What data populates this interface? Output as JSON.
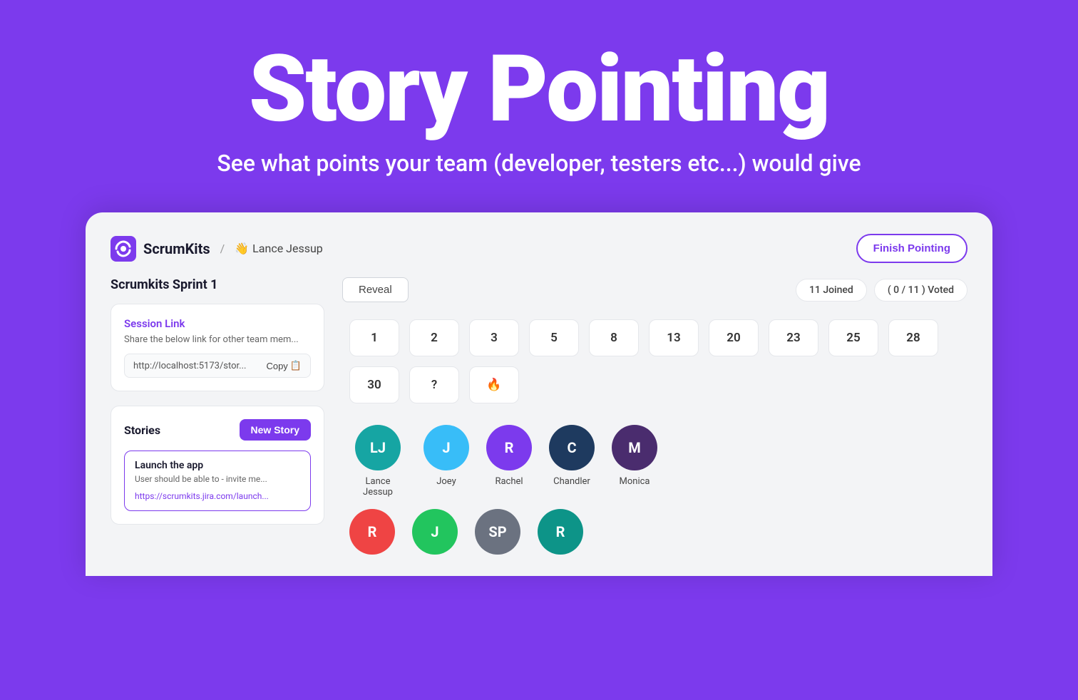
{
  "hero": {
    "title": "Story Pointing",
    "subtitle": "See what points your team (developer, testers etc...) would give"
  },
  "header": {
    "brand_name": "ScrumKits",
    "separator": "/",
    "user_emoji": "👋",
    "user_name": "Lance Jessup",
    "finish_btn": "Finish Pointing"
  },
  "left": {
    "sprint_title": "Scrumkits Sprint 1",
    "session_card": {
      "title": "Session Link",
      "desc": "Share the below link for other team mem...",
      "link_text": "http://localhost:5173/stor...",
      "copy_label": "Copy",
      "copy_icon": "📋"
    },
    "stories": {
      "label": "Stories",
      "new_story_btn": "New Story",
      "items": [
        {
          "name": "Launch the app",
          "desc": "User should be able to - invite me...",
          "link": "https://scrumkits.jira.com/launch..."
        }
      ]
    }
  },
  "right": {
    "reveal_btn": "Reveal",
    "badges": {
      "joined": "11 Joined",
      "voted": "( 0 / 11 ) Voted"
    },
    "point_values": [
      "1",
      "2",
      "3",
      "5",
      "8",
      "13",
      "20",
      "23",
      "25",
      "28",
      "30",
      "?",
      "🔥"
    ],
    "participants_row1": [
      {
        "initials": "LJ",
        "name": "Lance Jessup",
        "color": "#16a5a3"
      },
      {
        "initials": "J",
        "name": "Joey",
        "color": "#38bdf8"
      },
      {
        "initials": "R",
        "name": "Rachel",
        "color": "#7c3aed"
      },
      {
        "initials": "C",
        "name": "Chandler",
        "color": "#1e3a5f"
      },
      {
        "initials": "M",
        "name": "Monica",
        "color": "#4a2c6e"
      }
    ],
    "participants_row2": [
      {
        "initials": "R",
        "name": "",
        "color": "#ef4444"
      },
      {
        "initials": "J",
        "name": "",
        "color": "#22c55e"
      },
      {
        "initials": "SP",
        "name": "",
        "color": "#6b7280"
      },
      {
        "initials": "R",
        "name": "",
        "color": "#0d9488"
      }
    ]
  }
}
